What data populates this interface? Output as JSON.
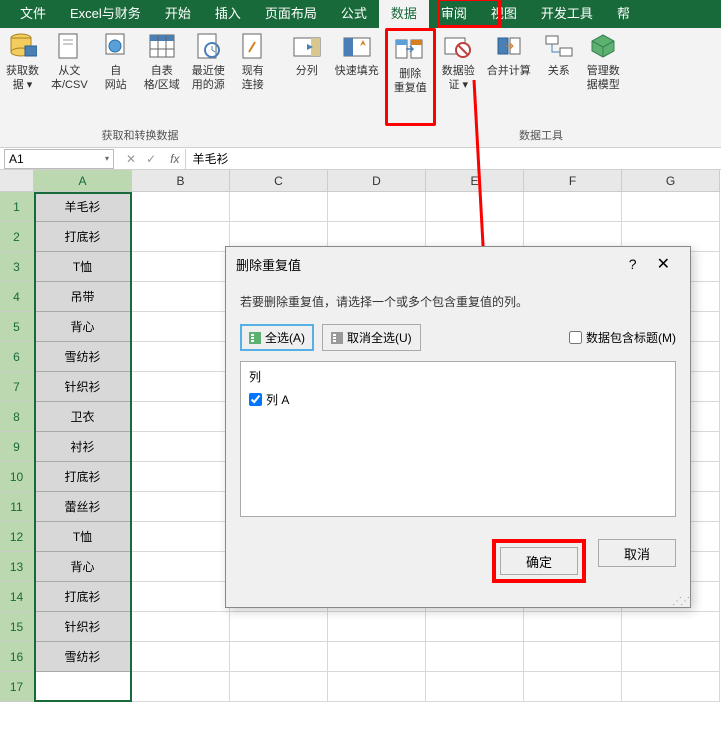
{
  "menu": {
    "items": [
      "文件",
      "Excel与财务",
      "开始",
      "插入",
      "页面布局",
      "公式",
      "数据",
      "审阅",
      "视图",
      "开发工具",
      "帮"
    ],
    "active_index": 6
  },
  "ribbon": {
    "buttons": [
      {
        "label": "获取数\n据 ▾",
        "icon": "db"
      },
      {
        "label": "从文\n本/CSV",
        "icon": "doc"
      },
      {
        "label": "自\n网站",
        "icon": "globe"
      },
      {
        "label": "自表\n格/区域",
        "icon": "table"
      },
      {
        "label": "最近使\n用的源",
        "icon": "recent"
      },
      {
        "label": "现有\n连接",
        "icon": "conn"
      },
      {
        "label": "分列",
        "icon": "split"
      },
      {
        "label": "快速填充",
        "icon": "fill"
      },
      {
        "label": "删除\n重复值",
        "icon": "dup"
      },
      {
        "label": "数据验\n证 ▾",
        "icon": "valid"
      },
      {
        "label": "合并计算",
        "icon": "consol"
      },
      {
        "label": "关系",
        "icon": "rel"
      },
      {
        "label": "管理数\n据模型",
        "icon": "model"
      }
    ],
    "group1": "获取和转换数据",
    "group2": "数据工具"
  },
  "name_box": "A1",
  "formula": "羊毛衫",
  "columns": [
    "A",
    "B",
    "C",
    "D",
    "E",
    "F",
    "G"
  ],
  "rows": [
    "羊毛衫",
    "打底衫",
    "T恤",
    "吊带",
    "背心",
    "雪纺衫",
    "针织衫",
    "卫衣",
    "衬衫",
    "打底衫",
    "蕾丝衫",
    "T恤",
    "背心",
    "打底衫",
    "针织衫",
    "雪纺衫",
    ""
  ],
  "dialog": {
    "title": "删除重复值",
    "desc": "若要删除重复值，请选择一个或多个包含重复值的列。",
    "select_all": "全选(A)",
    "unselect_all": "取消全选(U)",
    "has_header": "数据包含标题(M)",
    "col_header": "列",
    "col_item": "列 A",
    "ok": "确定",
    "cancel": "取消",
    "help": "?",
    "close": "✕"
  }
}
